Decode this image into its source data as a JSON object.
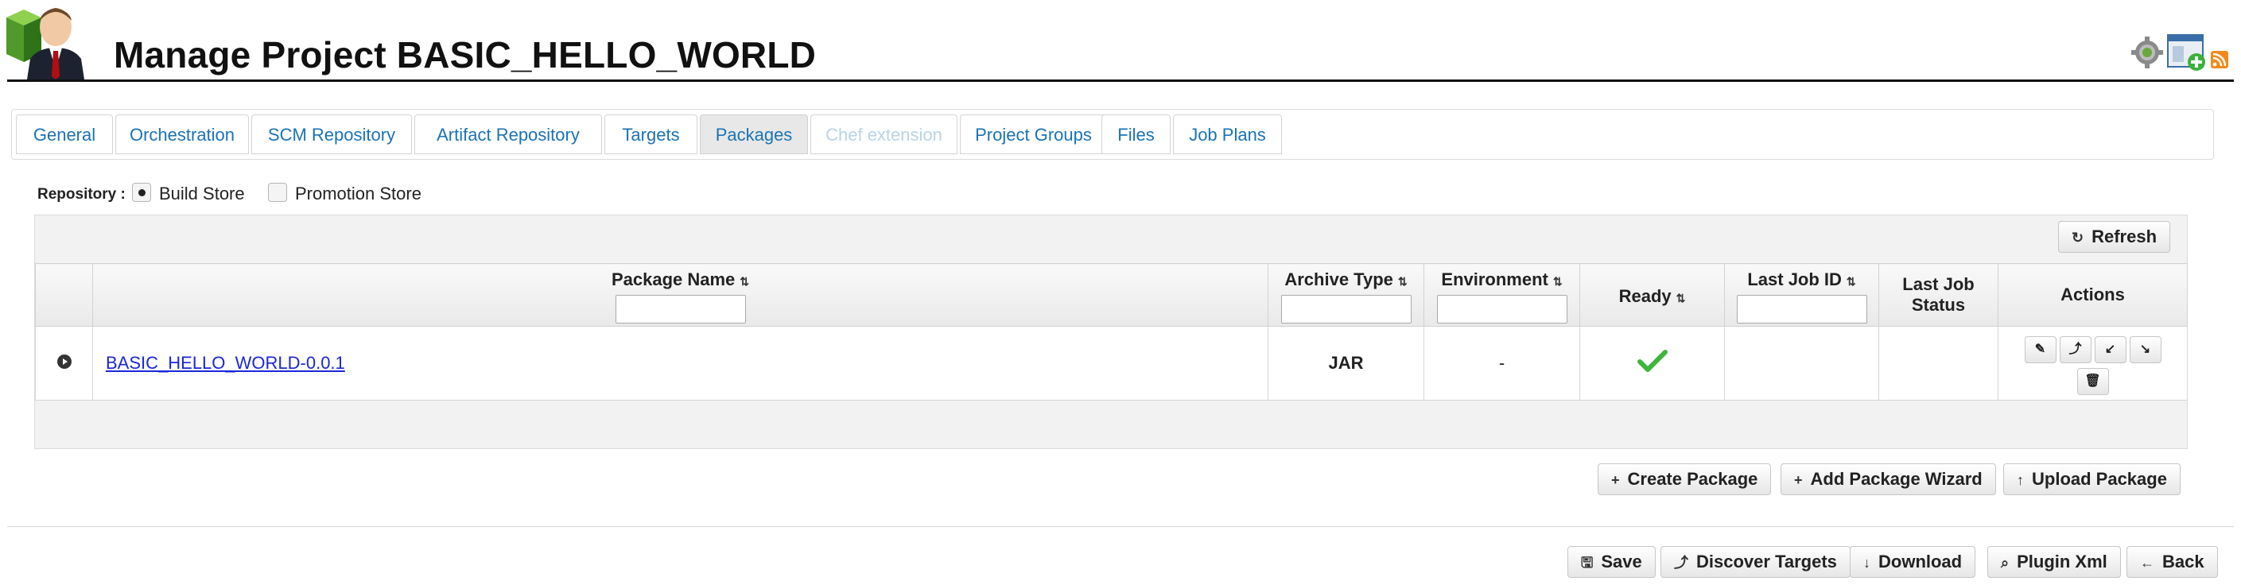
{
  "header": {
    "title": "Manage Project BASIC_HELLO_WORLD",
    "icons": [
      "user-avatar-icon",
      "settings-gear-icon",
      "add-window-icon",
      "rss-icon"
    ]
  },
  "tabs": [
    {
      "label": "General",
      "state": "normal"
    },
    {
      "label": "Orchestration",
      "state": "normal"
    },
    {
      "label": "SCM Repository",
      "state": "normal"
    },
    {
      "label": "Artifact Repository",
      "state": "normal"
    },
    {
      "label": "Targets",
      "state": "normal"
    },
    {
      "label": "Packages",
      "state": "active"
    },
    {
      "label": "Chef extension",
      "state": "disabled"
    },
    {
      "label": "Project Groups",
      "state": "normal"
    },
    {
      "label": "Files",
      "state": "normal"
    },
    {
      "label": "Job Plans",
      "state": "normal"
    }
  ],
  "repository": {
    "label": "Repository :",
    "options": [
      {
        "label": "Build Store",
        "selected": true
      },
      {
        "label": "Promotion Store",
        "selected": false
      }
    ]
  },
  "grid": {
    "refresh_label": "Refresh",
    "columns": {
      "package_name": "Package Name",
      "archive_type": "Archive Type",
      "environment": "Environment",
      "ready": "Ready",
      "last_job_id": "Last Job ID",
      "last_job_status_1": "Last Job",
      "last_job_status_2": "Status",
      "actions": "Actions"
    },
    "rows": [
      {
        "package_name": "BASIC_HELLO_WORLD-0.0.1",
        "archive_type": "JAR",
        "environment": "-",
        "ready": true,
        "last_job_id": "",
        "last_job_status": ""
      }
    ]
  },
  "grid_buttons": {
    "create": "Create Package",
    "wizard": "Add Package Wizard",
    "upload": "Upload Package"
  },
  "footer_buttons": {
    "save": "Save",
    "discover": "Discover Targets",
    "download": "Download",
    "plugin_xml": "Plugin Xml",
    "back": "Back"
  },
  "colors": {
    "tab_text": "#1a73b5",
    "tab_disabled_text": "#b8d4ea",
    "link": "#1a27d8",
    "ready_check": "#3db53d"
  }
}
